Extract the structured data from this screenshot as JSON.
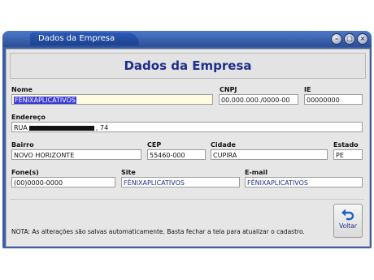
{
  "window": {
    "title": "Dados da Empresa"
  },
  "header": {
    "title": "Dados da Empresa"
  },
  "form": {
    "nome_label": "Nome",
    "nome_value": "FÊNIXAPLICATIVOS",
    "cnpj_label": "CNPJ",
    "cnpj_value": "00.000.000./0000-00",
    "ie_label": "IE",
    "ie_value": "00000000",
    "endereco_label": "Endereço",
    "endereco_prefix": "RUA",
    "endereco_suffix": ", 74",
    "bairro_label": "Bairro",
    "bairro_value": "NOVO HORIZONTE",
    "cep_label": "CEP",
    "cep_value": "55460-000",
    "cidade_label": "Cidade",
    "cidade_value": "CUPIRA",
    "estado_label": "Estado",
    "estado_value": "PE",
    "fone_label": "Fone(s)",
    "fone_value": "(00)0000-0000",
    "site_label": "Site",
    "site_value": "FÊNIXAPLICATIVOS",
    "email_label": "E-mail",
    "email_value": "FÊNIXAPLICATIVOS"
  },
  "footer": {
    "note": "NOTA: As alterações são salvas automaticamente. Basta fechar a tela para atualizar o cadastro.",
    "back_label": "Voltar"
  },
  "icons": {
    "back": "undo-arrow-icon",
    "minimize": "minimize-icon",
    "maximize": "maximize-icon",
    "close": "close-icon"
  },
  "colors": {
    "title_blue": "#1e2e8a",
    "window_blue": "#3b5ea5",
    "selection": "#3a3ad8"
  }
}
